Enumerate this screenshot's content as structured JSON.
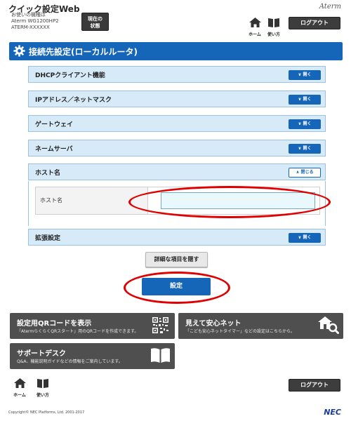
{
  "header": {
    "app_title": "クイック設定Web",
    "model_prefix": "お使いの機種は",
    "model": "Aterm WG1200HP2",
    "ssid": "ATERM-XXXXXX",
    "status_button_line1": "現在の",
    "status_button_line2": "状態",
    "brand": "Aterm",
    "home_label": "ホーム",
    "help_label": "使い方",
    "logout_label": "ログアウト"
  },
  "section": {
    "title": "接続先設定(ローカルルータ)"
  },
  "accordion": [
    {
      "label": "DHCPクライアント機能",
      "button": "開く",
      "state": "closed"
    },
    {
      "label": "IPアドレス／ネットマスク",
      "button": "開く",
      "state": "closed"
    },
    {
      "label": "ゲートウェイ",
      "button": "開く",
      "state": "closed"
    },
    {
      "label": "ネームサーバ",
      "button": "開く",
      "state": "closed"
    },
    {
      "label": "ホスト名",
      "button": "閉じる",
      "state": "open"
    },
    {
      "label": "拡張設定",
      "button": "開く",
      "state": "closed"
    }
  ],
  "host_form": {
    "label": "ホスト名",
    "value": "",
    "placeholder": ""
  },
  "actions": {
    "detail_toggle": "詳細な項目を隠す",
    "save": "設定"
  },
  "cards": {
    "qr": {
      "title": "設定用QRコードを表示",
      "desc": "「AtermらくらくQRスタート」用のQRコードを作成できます。"
    },
    "safe": {
      "title": "見えて安心ネット",
      "desc": "「こども安心ネットタイマー」などの設定はこちらから。"
    },
    "support": {
      "title": "サポートデスク",
      "desc": "Q&A、機能説明ガイドなどの情報をご案内しています。"
    }
  },
  "footer": {
    "home_label": "ホーム",
    "help_label": "使い方",
    "logout_label": "ログアウト",
    "copyright": "Copyright© NEC Platforms, Ltd. 2001-2017",
    "logo": "NEC"
  },
  "colors": {
    "primary_blue": "#1565b8",
    "accordion_bg": "#d7eaf8",
    "dark_button": "#3d3d3d",
    "highlight_red": "#e00000"
  }
}
